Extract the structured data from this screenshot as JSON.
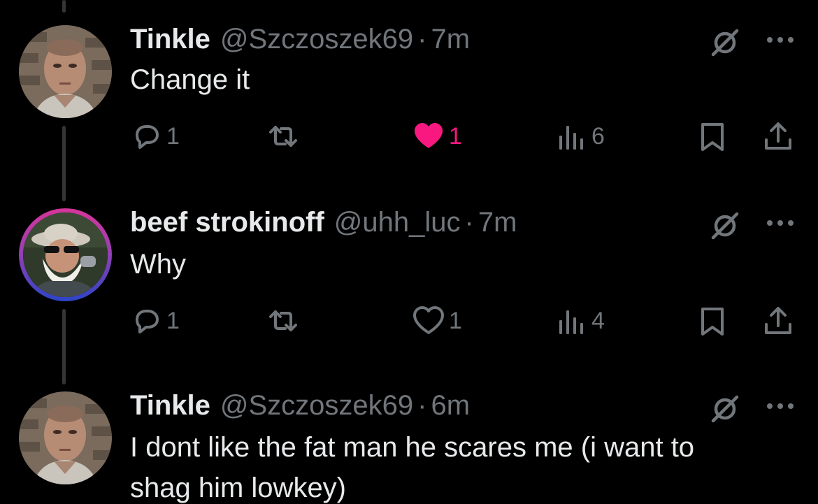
{
  "tweets": [
    {
      "name": "Tinkle",
      "handle": "@Szczoszek69",
      "sep": "·",
      "time": "7m",
      "text": "Change it",
      "replies": "1",
      "likes": "1",
      "liked": true,
      "views": "6"
    },
    {
      "name": "beef strokinoff",
      "handle": "@uhh_luc",
      "sep": "·",
      "time": "7m",
      "text": "Why",
      "replies": "1",
      "likes": "1",
      "liked": false,
      "views": "4"
    },
    {
      "name": "Tinkle",
      "handle": "@Szczoszek69",
      "sep": "·",
      "time": "6m",
      "text": "I dont like the fat man he scares me (i want to",
      "text_line2": "shag him lowkey)"
    }
  ],
  "colors": {
    "background": "#000000",
    "primary_text": "#e7e9ea",
    "secondary_text": "#71767b",
    "like_pink": "#f91880",
    "thread_line": "#333639"
  },
  "icons": [
    "reply-icon",
    "retweet-icon",
    "like-icon",
    "views-icon",
    "bookmark-icon",
    "share-icon",
    "grok-icon",
    "more-icon"
  ]
}
